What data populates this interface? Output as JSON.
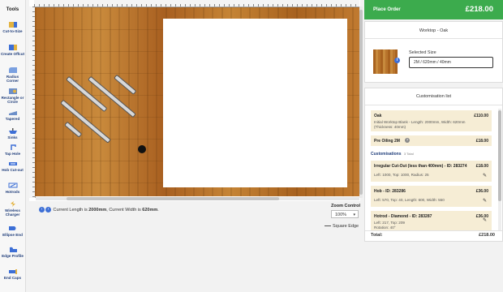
{
  "toolbar": {
    "title": "Tools",
    "items": [
      {
        "label": "Cut-to-Size",
        "icon": "cut-to-size-icon"
      },
      {
        "label": "Create Offcut",
        "icon": "create-offcut-icon"
      },
      {
        "label": "Radius Corner",
        "icon": "radius-corner-icon"
      },
      {
        "label": "Rectangle or Circle",
        "icon": "rectangle-circle-icon"
      },
      {
        "label": "Tapered",
        "icon": "tapered-icon"
      },
      {
        "label": "Sinks",
        "icon": "sink-icon"
      },
      {
        "label": "Tap Hole",
        "icon": "tap-hole-icon"
      },
      {
        "label": "Hob Cut-out",
        "icon": "hob-cutout-icon"
      },
      {
        "label": "Hotrods",
        "icon": "hotrods-icon"
      },
      {
        "label": "Wireless Charger",
        "icon": "wireless-charger-icon"
      },
      {
        "label": "Ellipse End",
        "icon": "ellipse-end-icon"
      },
      {
        "label": "Edge Profile",
        "icon": "edge-profile-icon"
      },
      {
        "label": "End Caps",
        "icon": "end-caps-icon"
      }
    ]
  },
  "canvas": {
    "dims_prefix": "Current Length is ",
    "length": "2000mm",
    "dims_mid": ", Current Width is ",
    "width": "620mm",
    "dims_suffix": ".",
    "zoom_label": "Zoom Control",
    "zoom_value": "100%",
    "edge_legend": "Square Edge"
  },
  "order": {
    "label": "Place Order",
    "price": "£218.00"
  },
  "product": {
    "title": "Worktop - Oak",
    "size_label": "Selected Size",
    "size_value": "2M / 620mm / 40mm"
  },
  "customisation": {
    "title": "Customisation list",
    "base": {
      "name": "Oak",
      "price": "£110.00",
      "desc1": "Initial Worktop Blank - Length: 2000mm, Width: 620mm",
      "desc2": "(Thickness: 40mm)"
    },
    "oiling": {
      "name": "Pre Oiling 2M",
      "price": "£18.00"
    },
    "section_label": "Customisations",
    "section_count": "3 Total",
    "items": [
      {
        "name": "Irregular Cut-Out (less than 400mm) - ID: 283274",
        "price": "£18.00",
        "desc": "Left: 1000, Top: 1000, Radius: 25"
      },
      {
        "name": "Hob - ID: 283286",
        "price": "£36.00",
        "desc": "Left: 570, Top: 40, Length: 600, Width: 550"
      },
      {
        "name": "Hotrod - Diamond - ID: 283287",
        "price": "£36.00",
        "desc": "Left: 217, Top: 209",
        "desc2": "Rotation: 40°"
      }
    ],
    "total_label": "Total:",
    "total_value": "£218.00"
  }
}
